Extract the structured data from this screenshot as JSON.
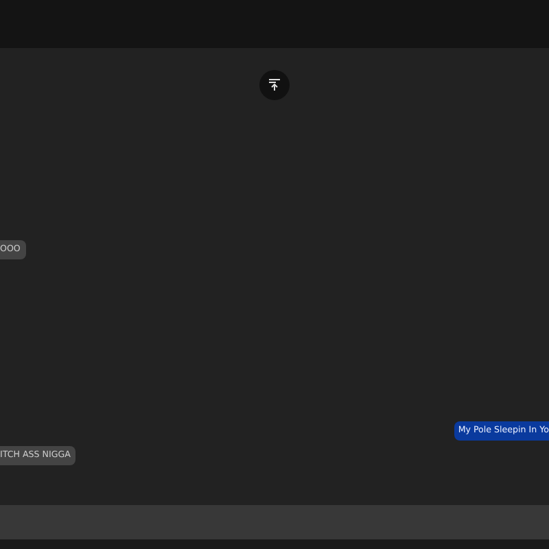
{
  "messages": [
    {
      "kind": "received",
      "text": "OOO"
    },
    {
      "kind": "sent",
      "text": "My Pole Sleepin In Yo"
    },
    {
      "kind": "received",
      "text": "ITCH ASS NIGGA"
    }
  ]
}
